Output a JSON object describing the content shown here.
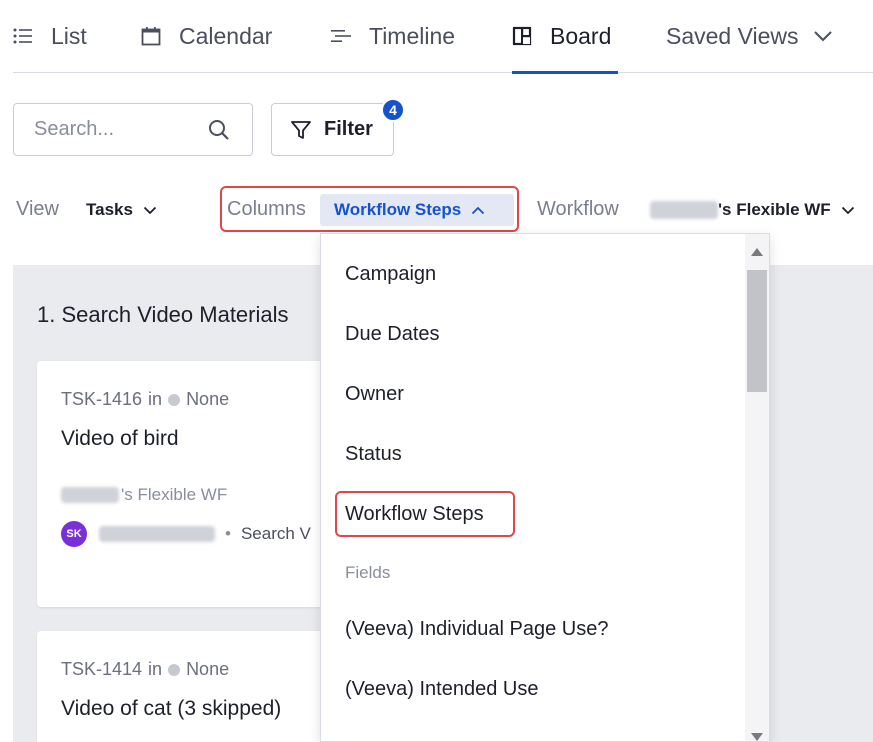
{
  "tabs": {
    "list": "List",
    "calendar": "Calendar",
    "timeline": "Timeline",
    "board": "Board",
    "saved_views": "Saved Views"
  },
  "toolbar": {
    "search_placeholder": "Search...",
    "filter_label": "Filter",
    "filter_count": "4"
  },
  "view_row": {
    "view_label": "View",
    "view_value": "Tasks",
    "columns_label": "Columns",
    "columns_value": "Workflow Steps",
    "workflow_label": "Workflow",
    "workflow_value": "'s Flexible WF"
  },
  "board": {
    "column_title": "1. Search Video Materials",
    "cards": [
      {
        "id": "TSK-1416",
        "in_label": "in",
        "status": "None",
        "title": "Video of bird",
        "workflow": "'s Flexible WF",
        "avatar": "SK",
        "step": "Search V"
      },
      {
        "id": "TSK-1414",
        "in_label": "in",
        "status": "None",
        "title": "Video of cat (3 skipped)"
      }
    ]
  },
  "dropdown": {
    "items": [
      "Campaign",
      "Due Dates",
      "Owner",
      "Status",
      "Workflow Steps"
    ],
    "section": "Fields",
    "fields": [
      "(Veeva) Individual Page Use?",
      "(Veeva) Intended Use"
    ]
  },
  "colors": {
    "accent": "#1452ce",
    "highlight_border": "#e0474c",
    "avatar": "#7b2fd6"
  }
}
